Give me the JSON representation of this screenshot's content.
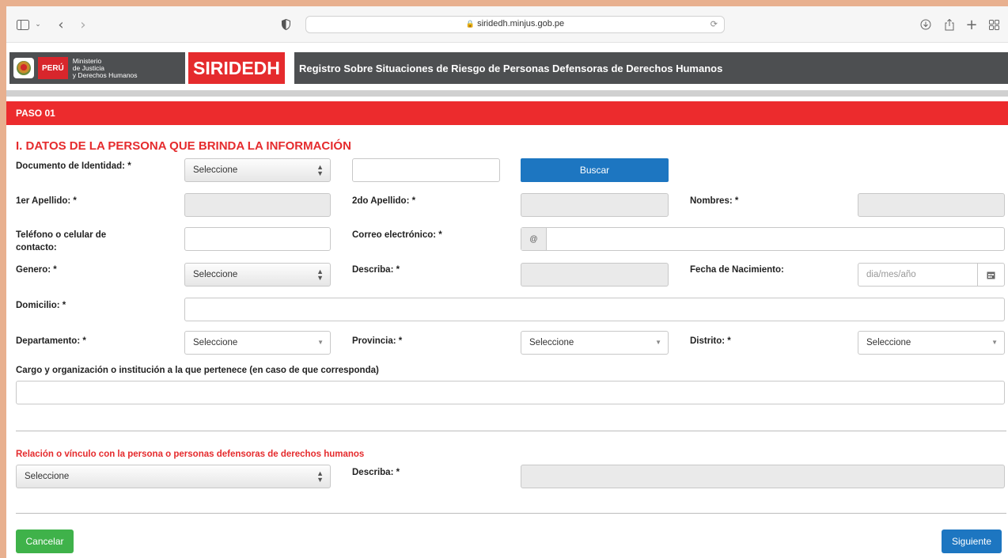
{
  "browser": {
    "url": "siridedh.minjus.gob.pe"
  },
  "header": {
    "country": "PERÚ",
    "ministry_line1": "Ministerio",
    "ministry_line2": "de Justicia",
    "ministry_line3": "y Derechos Humanos",
    "app_name": "SIRIDEDH",
    "subtitle": "Registro Sobre Situaciones de Riesgo de Personas Defensoras de Derechos Humanos"
  },
  "step": {
    "label": "PASO 01"
  },
  "section": {
    "title": "I. DATOS DE LA PERSONA QUE BRINDA LA INFORMACIÓN"
  },
  "form": {
    "documento_label": "Documento de Identidad: *",
    "documento_select": "Seleccione",
    "buscar_label": "Buscar",
    "apellido1_label": "1er Apellido: *",
    "apellido2_label": "2do Apellido: *",
    "nombres_label": "Nombres: *",
    "telefono_label_1": "Teléfono o celular de",
    "telefono_label_2": "contacto:",
    "correo_label": "Correo electrónico: *",
    "correo_addon": "@",
    "genero_label": "Genero: *",
    "genero_select": "Seleccione",
    "describa_label": "Describa: *",
    "fecha_label": "Fecha de Nacimiento:",
    "fecha_placeholder": "dia/mes/año",
    "domicilio_label": "Domicilio: *",
    "departamento_label": "Departamento: *",
    "departamento_select": "Seleccione",
    "provincia_label": "Provincia: *",
    "provincia_select": "Seleccione",
    "distrito_label": "Distrito: *",
    "distrito_select": "Seleccione",
    "cargo_label": "Cargo y organización o institución a la que pertenece (en caso de que corresponda)"
  },
  "relation": {
    "title": "Relación o vínculo con la persona o personas defensoras de derechos humanos",
    "select": "Seleccione",
    "describa_label": "Describa: *"
  },
  "footer": {
    "cancel_label": "Cancelar",
    "next_label": "Siguiente"
  },
  "colors": {
    "brand_red": "#e52b2d",
    "header_gray": "#4d4f51",
    "primary_blue": "#1d76c1",
    "cancel_green": "#3fb24a"
  }
}
